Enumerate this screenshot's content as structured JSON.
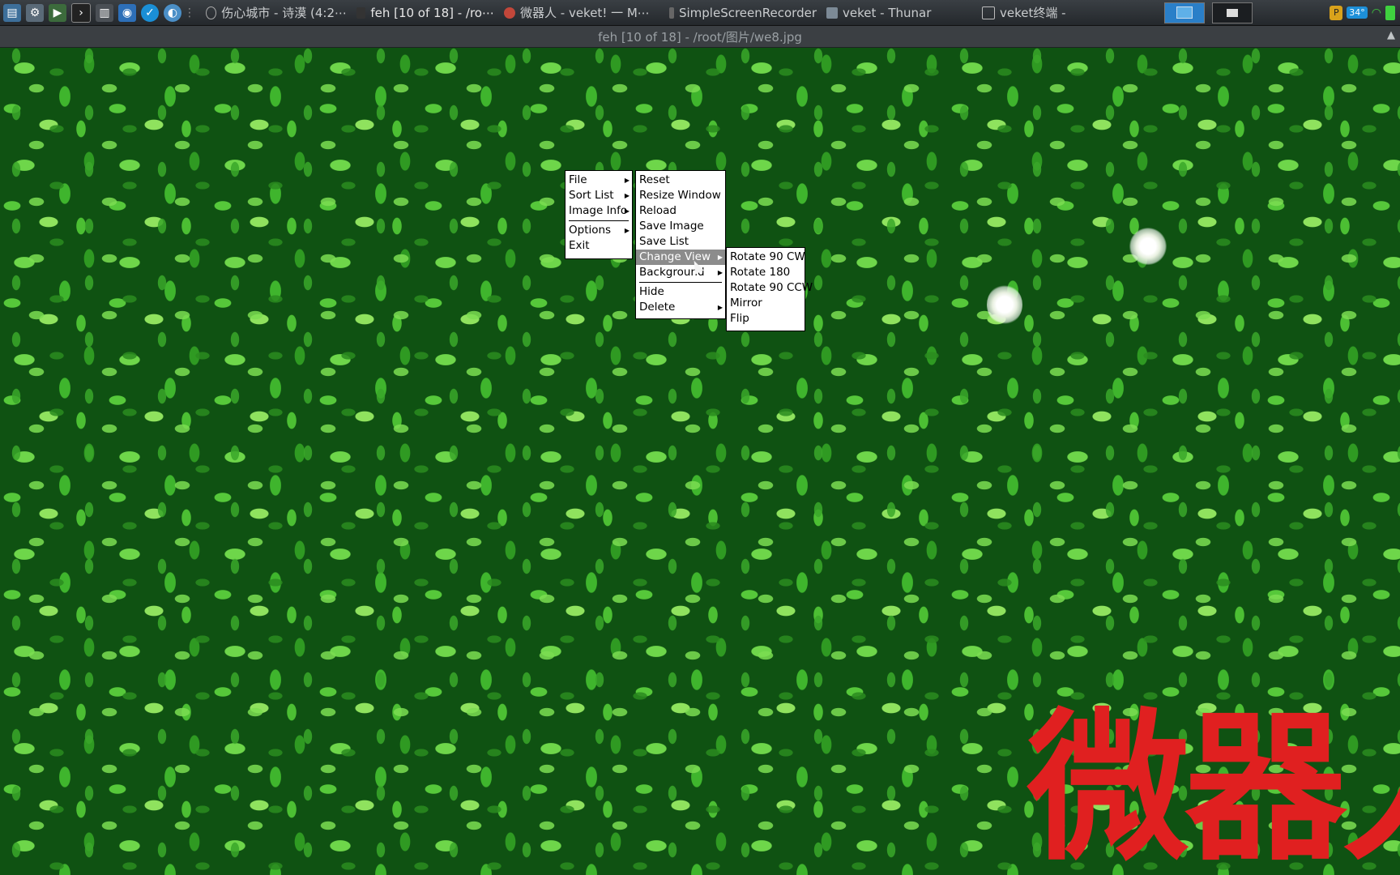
{
  "taskbar": {
    "tasks": [
      {
        "label": "伤心城市 - 诗漠 (4:2⋯",
        "icon": "music-icon"
      },
      {
        "label": "feh [10 of 18] - /ro⋯",
        "icon": "image-viewer-icon"
      },
      {
        "label": "微器人 - veket! 一 M⋯",
        "icon": "browser-icon"
      },
      {
        "label": "SimpleScreenRecorder",
        "icon": "recorder-icon"
      },
      {
        "label": "veket - Thunar",
        "icon": "folder-icon"
      },
      {
        "label": "veket终端 -",
        "icon": "terminal-icon"
      }
    ],
    "tray": {
      "temp_badge": "34°"
    }
  },
  "window": {
    "title": "feh [10 of 18] - /root/图片/we8.jpg"
  },
  "watermark": "微器人",
  "menu_main": {
    "items": [
      "File",
      "Sort List",
      "Image Info",
      "Options",
      "Exit"
    ]
  },
  "menu_file": {
    "items": [
      "Reset",
      "Resize Window",
      "Reload",
      "Save Image",
      "Save List",
      "Change View",
      "Background",
      "Hide",
      "Delete"
    ],
    "highlighted": "Change View"
  },
  "menu_change_view": {
    "items": [
      "Rotate 90 CW",
      "Rotate 180",
      "Rotate 90 CCW",
      "Mirror",
      "Flip"
    ]
  },
  "colors": {
    "watermark": "#e02020",
    "menu_highlight": "#8c8c8c",
    "taskbar": "#2b2f33"
  }
}
